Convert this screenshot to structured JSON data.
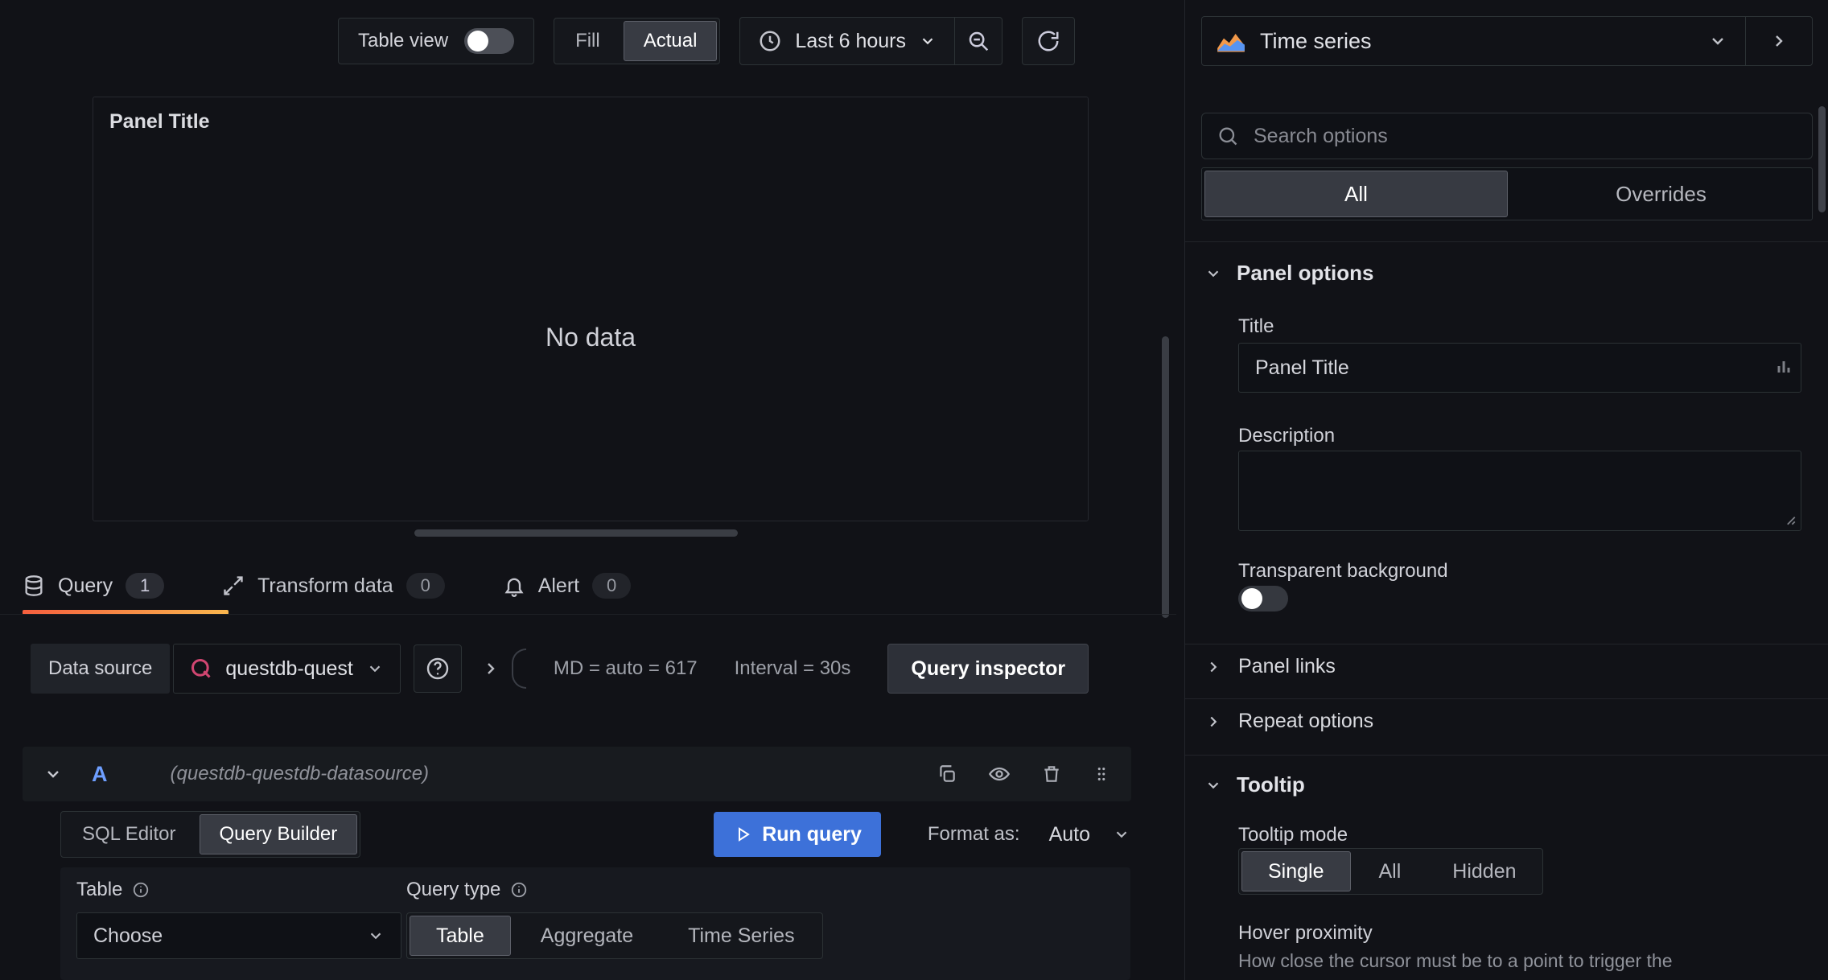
{
  "topbar": {
    "table_view": "Table view",
    "fill": "Fill",
    "actual": "Actual",
    "time_range": "Last 6 hours"
  },
  "panel": {
    "title": "Panel Title",
    "no_data": "No data"
  },
  "tabs": {
    "query": "Query",
    "query_count": "1",
    "transform": "Transform data",
    "transform_count": "0",
    "alert": "Alert",
    "alert_count": "0"
  },
  "query": {
    "datasource_label": "Data source",
    "datasource_name": "questdb-quest",
    "max_data_points": "MD = auto = 617",
    "interval": "Interval = 30s",
    "inspector": "Query inspector",
    "ref_id": "A",
    "ref_hint": "(questdb-questdb-datasource)",
    "sql_editor": "SQL Editor",
    "query_builder": "Query Builder",
    "run_query": "Run query",
    "format_as": "Format as:",
    "format_value": "Auto",
    "table_label": "Table",
    "table_value": "Choose",
    "query_type_label": "Query type",
    "type_table": "Table",
    "type_aggregate": "Aggregate",
    "type_timeseries": "Time Series"
  },
  "options": {
    "viz": "Time series",
    "search_placeholder": "Search options",
    "tab_all": "All",
    "tab_overrides": "Overrides",
    "panel_options": "Panel options",
    "title_label": "Title",
    "title_value": "Panel Title",
    "description_label": "Description",
    "transparent": "Transparent background",
    "panel_links": "Panel links",
    "repeat_options": "Repeat options",
    "tooltip": "Tooltip",
    "tooltip_mode": "Tooltip mode",
    "mode_single": "Single",
    "mode_all": "All",
    "mode_hidden": "Hidden",
    "hover_label": "Hover proximity",
    "hover_help": "How close the cursor must be to a point to trigger the"
  },
  "colors": {
    "accent_orange": "#f55f3e",
    "primary_blue": "#3d71d9",
    "questdb_pink": "#d14671",
    "refid_blue": "#6e9fff",
    "background": "#111217",
    "surface": "#181b1f"
  }
}
